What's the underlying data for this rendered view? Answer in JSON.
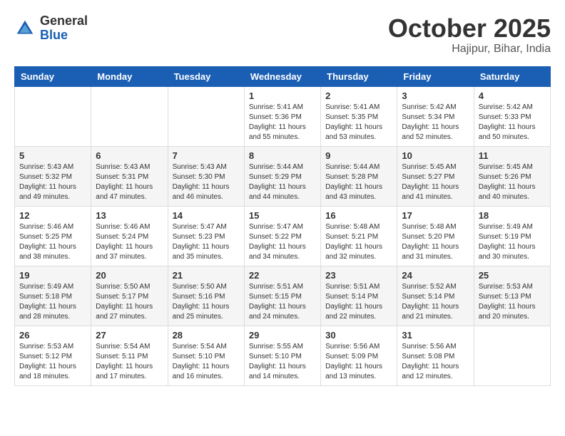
{
  "header": {
    "logo_general": "General",
    "logo_blue": "Blue",
    "month": "October 2025",
    "location": "Hajipur, Bihar, India"
  },
  "days_of_week": [
    "Sunday",
    "Monday",
    "Tuesday",
    "Wednesday",
    "Thursday",
    "Friday",
    "Saturday"
  ],
  "weeks": [
    [
      {
        "day": "",
        "info": ""
      },
      {
        "day": "",
        "info": ""
      },
      {
        "day": "",
        "info": ""
      },
      {
        "day": "1",
        "info": "Sunrise: 5:41 AM\nSunset: 5:36 PM\nDaylight: 11 hours\nand 55 minutes."
      },
      {
        "day": "2",
        "info": "Sunrise: 5:41 AM\nSunset: 5:35 PM\nDaylight: 11 hours\nand 53 minutes."
      },
      {
        "day": "3",
        "info": "Sunrise: 5:42 AM\nSunset: 5:34 PM\nDaylight: 11 hours\nand 52 minutes."
      },
      {
        "day": "4",
        "info": "Sunrise: 5:42 AM\nSunset: 5:33 PM\nDaylight: 11 hours\nand 50 minutes."
      }
    ],
    [
      {
        "day": "5",
        "info": "Sunrise: 5:43 AM\nSunset: 5:32 PM\nDaylight: 11 hours\nand 49 minutes."
      },
      {
        "day": "6",
        "info": "Sunrise: 5:43 AM\nSunset: 5:31 PM\nDaylight: 11 hours\nand 47 minutes."
      },
      {
        "day": "7",
        "info": "Sunrise: 5:43 AM\nSunset: 5:30 PM\nDaylight: 11 hours\nand 46 minutes."
      },
      {
        "day": "8",
        "info": "Sunrise: 5:44 AM\nSunset: 5:29 PM\nDaylight: 11 hours\nand 44 minutes."
      },
      {
        "day": "9",
        "info": "Sunrise: 5:44 AM\nSunset: 5:28 PM\nDaylight: 11 hours\nand 43 minutes."
      },
      {
        "day": "10",
        "info": "Sunrise: 5:45 AM\nSunset: 5:27 PM\nDaylight: 11 hours\nand 41 minutes."
      },
      {
        "day": "11",
        "info": "Sunrise: 5:45 AM\nSunset: 5:26 PM\nDaylight: 11 hours\nand 40 minutes."
      }
    ],
    [
      {
        "day": "12",
        "info": "Sunrise: 5:46 AM\nSunset: 5:25 PM\nDaylight: 11 hours\nand 38 minutes."
      },
      {
        "day": "13",
        "info": "Sunrise: 5:46 AM\nSunset: 5:24 PM\nDaylight: 11 hours\nand 37 minutes."
      },
      {
        "day": "14",
        "info": "Sunrise: 5:47 AM\nSunset: 5:23 PM\nDaylight: 11 hours\nand 35 minutes."
      },
      {
        "day": "15",
        "info": "Sunrise: 5:47 AM\nSunset: 5:22 PM\nDaylight: 11 hours\nand 34 minutes."
      },
      {
        "day": "16",
        "info": "Sunrise: 5:48 AM\nSunset: 5:21 PM\nDaylight: 11 hours\nand 32 minutes."
      },
      {
        "day": "17",
        "info": "Sunrise: 5:48 AM\nSunset: 5:20 PM\nDaylight: 11 hours\nand 31 minutes."
      },
      {
        "day": "18",
        "info": "Sunrise: 5:49 AM\nSunset: 5:19 PM\nDaylight: 11 hours\nand 30 minutes."
      }
    ],
    [
      {
        "day": "19",
        "info": "Sunrise: 5:49 AM\nSunset: 5:18 PM\nDaylight: 11 hours\nand 28 minutes."
      },
      {
        "day": "20",
        "info": "Sunrise: 5:50 AM\nSunset: 5:17 PM\nDaylight: 11 hours\nand 27 minutes."
      },
      {
        "day": "21",
        "info": "Sunrise: 5:50 AM\nSunset: 5:16 PM\nDaylight: 11 hours\nand 25 minutes."
      },
      {
        "day": "22",
        "info": "Sunrise: 5:51 AM\nSunset: 5:15 PM\nDaylight: 11 hours\nand 24 minutes."
      },
      {
        "day": "23",
        "info": "Sunrise: 5:51 AM\nSunset: 5:14 PM\nDaylight: 11 hours\nand 22 minutes."
      },
      {
        "day": "24",
        "info": "Sunrise: 5:52 AM\nSunset: 5:14 PM\nDaylight: 11 hours\nand 21 minutes."
      },
      {
        "day": "25",
        "info": "Sunrise: 5:53 AM\nSunset: 5:13 PM\nDaylight: 11 hours\nand 20 minutes."
      }
    ],
    [
      {
        "day": "26",
        "info": "Sunrise: 5:53 AM\nSunset: 5:12 PM\nDaylight: 11 hours\nand 18 minutes."
      },
      {
        "day": "27",
        "info": "Sunrise: 5:54 AM\nSunset: 5:11 PM\nDaylight: 11 hours\nand 17 minutes."
      },
      {
        "day": "28",
        "info": "Sunrise: 5:54 AM\nSunset: 5:10 PM\nDaylight: 11 hours\nand 16 minutes."
      },
      {
        "day": "29",
        "info": "Sunrise: 5:55 AM\nSunset: 5:10 PM\nDaylight: 11 hours\nand 14 minutes."
      },
      {
        "day": "30",
        "info": "Sunrise: 5:56 AM\nSunset: 5:09 PM\nDaylight: 11 hours\nand 13 minutes."
      },
      {
        "day": "31",
        "info": "Sunrise: 5:56 AM\nSunset: 5:08 PM\nDaylight: 11 hours\nand 12 minutes."
      },
      {
        "day": "",
        "info": ""
      }
    ]
  ]
}
